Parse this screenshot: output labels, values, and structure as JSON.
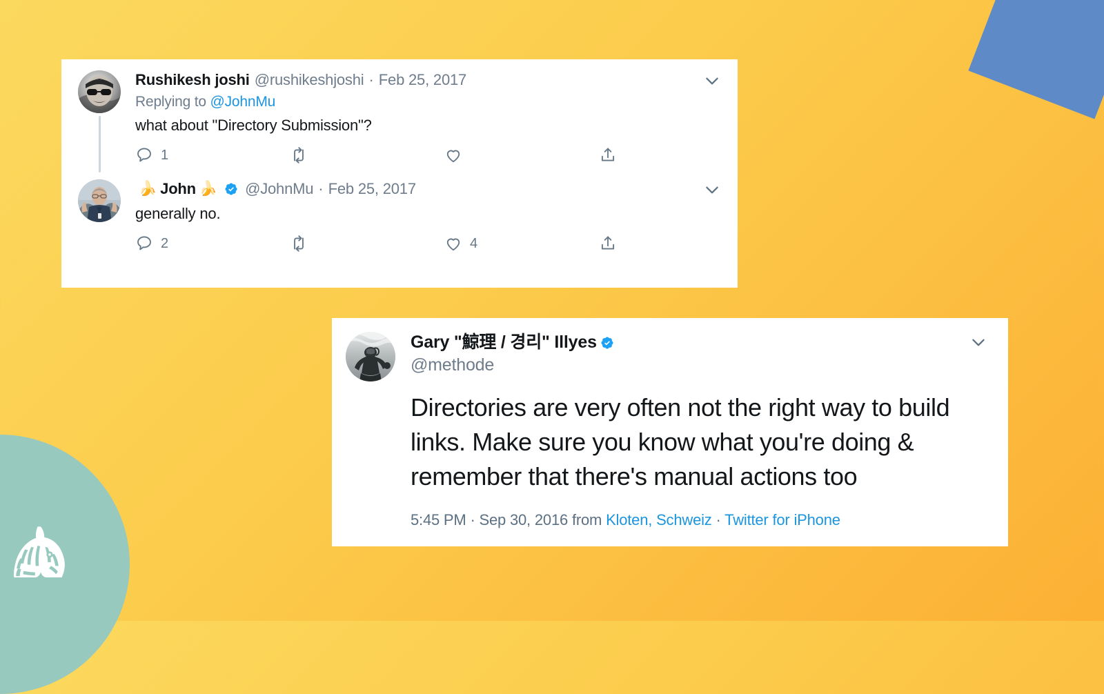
{
  "background": {
    "gradient_from": "#FBD95E",
    "gradient_to": "#FCB034",
    "accent_blue": "#5E8AC7",
    "accent_teal": "#97C9BF",
    "link_blue": "#1B95E0",
    "verified_blue": "#1DA1F2",
    "muted_text": "#6E7C8C"
  },
  "logo": {
    "name": "zebra-head-logo"
  },
  "thread_card": {
    "tweets": [
      {
        "avatar_alt": "rushikesh-joshi-avatar",
        "display_name": "Rushikesh joshi",
        "handle": "@rushikeshjoshi",
        "separator": "·",
        "timestamp": "Feb 25, 2017",
        "verified": false,
        "replying_label": "Replying to",
        "replying_mention": "@JohnMu",
        "text": "what about \"Directory Submission\"?",
        "actions": {
          "reply_count": "1",
          "retweet_count": "",
          "like_count": "",
          "share_label": ""
        },
        "caret": "chevron-down"
      },
      {
        "avatar_alt": "john-mueller-avatar",
        "display_name": "John",
        "emoji_left": "🍌",
        "emoji_right": "🍌",
        "handle": "@JohnMu",
        "separator": "·",
        "timestamp": "Feb 25, 2017",
        "verified": true,
        "text": "generally no.",
        "actions": {
          "reply_count": "2",
          "retweet_count": "",
          "like_count": "4",
          "share_label": ""
        },
        "caret": "chevron-down"
      }
    ]
  },
  "single_card": {
    "avatar_alt": "gary-illyes-avatar",
    "display_name": "Gary \"鯨理 / 경리\" Illyes",
    "verified": true,
    "handle": "@methode",
    "text": "Directories are very often not the right way to build links. Make sure you know what you're doing & remember that there's manual actions too",
    "meta": {
      "time": "5:45 PM",
      "sep1": "·",
      "date": "Sep 30, 2016",
      "from_label": "from",
      "location": "Kloten, Schweiz",
      "sep2": "·",
      "source": "Twitter for iPhone"
    },
    "caret": "chevron-down"
  }
}
